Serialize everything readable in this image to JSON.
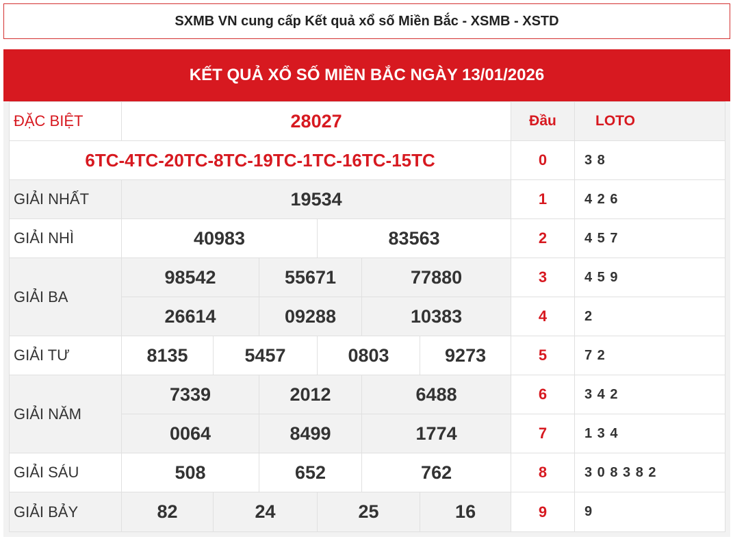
{
  "header": {
    "title": "SXMB VN cung cấp Kết quả xổ số Miền Bắc - XSMB - XSTD"
  },
  "banner": {
    "title": "KẾT QUẢ XỔ SỐ MIỀN BẮC NGÀY 13/01/2026"
  },
  "prizes": {
    "special": {
      "label": "ĐẶC BIỆT",
      "value": "28027"
    },
    "codes": "6TC-4TC-20TC-8TC-19TC-1TC-16TC-15TC",
    "first": {
      "label": "GIẢI NHẤT",
      "values": [
        "19534"
      ]
    },
    "second": {
      "label": "GIẢI NHÌ",
      "values": [
        "40983",
        "83563"
      ]
    },
    "third": {
      "label": "GIẢI BA",
      "values": [
        "98542",
        "55671",
        "77880",
        "26614",
        "09288",
        "10383"
      ]
    },
    "fourth": {
      "label": "GIẢI TƯ",
      "values": [
        "8135",
        "5457",
        "0803",
        "9273"
      ]
    },
    "fifth": {
      "label": "GIẢI NĂM",
      "values": [
        "7339",
        "2012",
        "6488",
        "0064",
        "8499",
        "1774"
      ]
    },
    "sixth": {
      "label": "GIẢI SÁU",
      "values": [
        "508",
        "652",
        "762"
      ]
    },
    "seventh": {
      "label": "GIẢI BẢY",
      "values": [
        "82",
        "24",
        "25",
        "16"
      ]
    }
  },
  "loto": {
    "head_label": "Đầu",
    "loto_label": "LOTO",
    "rows": [
      {
        "head": "0",
        "nums": "3 8"
      },
      {
        "head": "1",
        "nums": "4 2 6"
      },
      {
        "head": "2",
        "nums": "4 5 7"
      },
      {
        "head": "3",
        "nums": "4 5 9"
      },
      {
        "head": "4",
        "nums": "2"
      },
      {
        "head": "5",
        "nums": "7 2"
      },
      {
        "head": "6",
        "nums": "3 4 2"
      },
      {
        "head": "7",
        "nums": "1 3 4"
      },
      {
        "head": "8",
        "nums": "3 0 8 3 8 2"
      },
      {
        "head": "9",
        "nums": "9"
      }
    ]
  }
}
